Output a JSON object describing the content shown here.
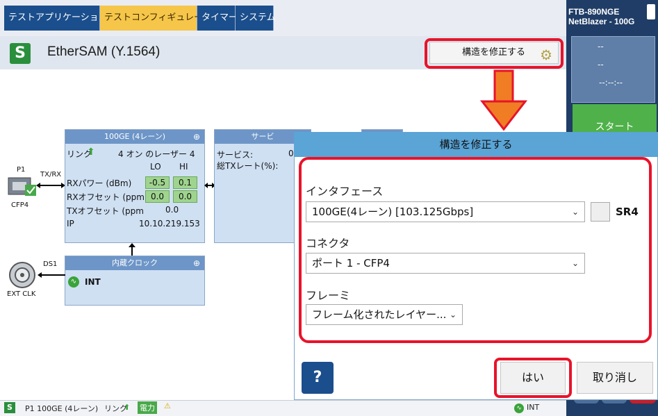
{
  "tabs": [
    {
      "label": "テストアプリケーション",
      "active": false
    },
    {
      "label": "テストコンフィギュレータ",
      "active": true
    },
    {
      "label": "タイマー",
      "active": false
    },
    {
      "label": "システム",
      "active": false
    }
  ],
  "app": {
    "title": "EtherSAM (Y.1564)",
    "modify_label": "構造を修正する"
  },
  "device": {
    "model": "FTB-890NGE",
    "name": "NetBlazer - 100G",
    "dash1": "--",
    "dash2": "--",
    "time": "--:--:--",
    "start_label": "スタート"
  },
  "port": {
    "id": "P1",
    "dir": "TX/RX",
    "cfp": "CFP4",
    "ds": "DS1",
    "ext": "EXT CLK"
  },
  "iface_block": {
    "title": "100GE (4レーン)",
    "link_label": "リンク",
    "laser": "4 オン のレーザー 4",
    "col_lo": "LO",
    "col_hi": "HI",
    "rx_power_label": "RXパワー (dBm)",
    "rx_power_lo": "-0.5",
    "rx_power_hi": "0.1",
    "rx_offset_label": "RXオフセット (ppm",
    "rx_offset_lo": "0.0",
    "rx_offset_hi": "0.0",
    "tx_offset_label": "TXオフセット (ppm",
    "tx_offset_val": "0.0",
    "ip_label": "IP",
    "ip_val": "10.10.219.153"
  },
  "service_block": {
    "title": "サービ",
    "svc_label": "サービス:",
    "svc_val": "0",
    "txrate_label": "総TXレート(%):"
  },
  "clock_block": {
    "title": "内蔵クロック",
    "int_label": "INT"
  },
  "dialog": {
    "title": "構造を修正する",
    "iface_label": "インタフェース",
    "iface_value": "100GE(4レーン) [103.125Gbps]",
    "sr4_label": "SR4",
    "connector_label": "コネクタ",
    "connector_value": "ポート 1 - CFP4",
    "frame_label": "フレーミ",
    "frame_value": "フレーム化されたレイヤー...",
    "help_label": "?",
    "yes_label": "はい",
    "cancel_label": "取り消し"
  },
  "status": {
    "port_info": "P1 100GE (4レーン)",
    "link": "リンク",
    "power": "電力",
    "int": "INT"
  }
}
